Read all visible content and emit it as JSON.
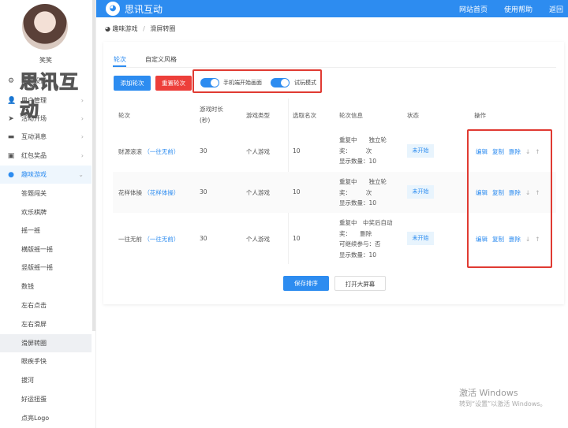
{
  "sidebar": {
    "user_name": "笑笑",
    "watermark": "思讯互动",
    "menu": [
      {
        "label": "活动设置",
        "icon": "gear-icon"
      },
      {
        "label": "用户管理",
        "icon": "user-icon"
      },
      {
        "label": "活动开场",
        "icon": "send-icon"
      },
      {
        "label": "互动消息",
        "icon": "message-icon"
      },
      {
        "label": "红包奖品",
        "icon": "gift-icon"
      },
      {
        "label": "趣味游戏",
        "icon": "game-icon"
      }
    ],
    "submenu": [
      "答题闯关",
      "欢乐棋牌",
      "摇一摇",
      "横版摇一摇",
      "竖版摇一摇",
      "数钱",
      "左右点击",
      "左右滑屏",
      "滑屏转圈",
      "眼疾手快",
      "拔河",
      "好运扭蛋",
      "点亮Logo"
    ]
  },
  "header": {
    "brand": "思讯互动",
    "links": [
      "网站首页",
      "使用帮助",
      "返回"
    ]
  },
  "breadcrumb": {
    "parent": "趣味游戏",
    "separator": "/",
    "current": "滑屏转圈"
  },
  "tabs": [
    "轮次",
    "自定义风格"
  ],
  "toolbar": {
    "add": "添加轮次",
    "reset": "重置轮次",
    "toggle1": "手机端开始画面",
    "toggle2": "试玩模式"
  },
  "table": {
    "headers": [
      "轮次",
      "游戏时长",
      "(秒)",
      "游戏类型",
      "选取名次",
      "轮次信息",
      "状态",
      "操作"
    ],
    "rows": [
      {
        "name": "财源滚滚",
        "theme": "（一往无前）",
        "duration": "30",
        "type": "个人游戏",
        "rank": "10",
        "info": [
          "重复中　　独立轮",
          "奖：　　　次",
          "显示数量：10"
        ],
        "status": "未开始"
      },
      {
        "name": "花样体操",
        "theme": "（花样体操）",
        "duration": "30",
        "type": "个人游戏",
        "rank": "10",
        "info": [
          "重复中　　独立轮",
          "奖：　　　次",
          "显示数量：10"
        ],
        "status": "未开始"
      },
      {
        "name": "一往无前",
        "theme": "（一往无前）",
        "duration": "30",
        "type": "个人游戏",
        "rank": "10",
        "info": [
          "重复中　中奖后自动",
          "奖：　　删除",
          "可继续参与：否",
          "显示数量：10"
        ],
        "status": "未开始"
      }
    ],
    "ops": {
      "edit": "编辑",
      "copy": "复制",
      "delete": "删除",
      "down": "↓",
      "up": "↑"
    }
  },
  "footer": {
    "save": "保存排序",
    "open": "打开大屏幕"
  },
  "windows": {
    "line1": "激活 Windows",
    "line2": "转到“设置”以激活 Windows。"
  },
  "colors": {
    "primary": "#2d8cf0",
    "danger": "#ed3f3a"
  }
}
